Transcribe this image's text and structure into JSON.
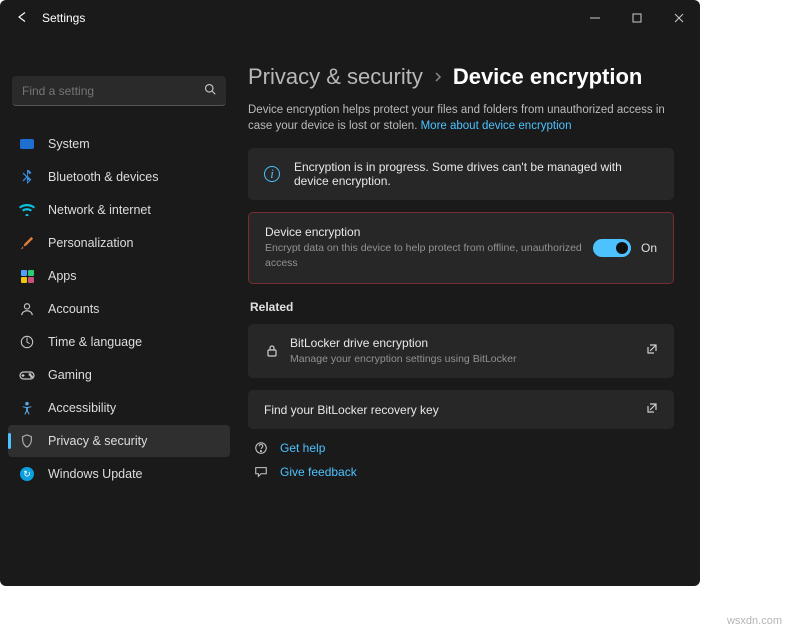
{
  "window": {
    "title": "Settings"
  },
  "search": {
    "placeholder": "Find a setting"
  },
  "sidebar": {
    "items": [
      {
        "id": "system",
        "label": "System"
      },
      {
        "id": "bluetooth",
        "label": "Bluetooth & devices"
      },
      {
        "id": "network",
        "label": "Network & internet"
      },
      {
        "id": "personalization",
        "label": "Personalization"
      },
      {
        "id": "apps",
        "label": "Apps"
      },
      {
        "id": "accounts",
        "label": "Accounts"
      },
      {
        "id": "time",
        "label": "Time & language"
      },
      {
        "id": "gaming",
        "label": "Gaming"
      },
      {
        "id": "accessibility",
        "label": "Accessibility"
      },
      {
        "id": "privacy",
        "label": "Privacy & security"
      },
      {
        "id": "update",
        "label": "Windows Update"
      }
    ],
    "active_index": 9
  },
  "breadcrumb": {
    "parent": "Privacy & security",
    "current": "Device encryption"
  },
  "description": {
    "text": "Device encryption helps protect your files and folders from unauthorized access in case your device is lost or stolen.",
    "link": "More about device encryption"
  },
  "info_banner": {
    "text": "Encryption is in progress. Some drives can't be managed with device encryption."
  },
  "encryption_card": {
    "title": "Device encryption",
    "subtitle": "Encrypt data on this device to help protect from offline, unauthorized access",
    "toggle_state": "On",
    "toggle_on": true
  },
  "related": {
    "heading": "Related",
    "bitlocker": {
      "title": "BitLocker drive encryption",
      "subtitle": "Manage your encryption settings using BitLocker"
    },
    "recovery": {
      "title": "Find your BitLocker recovery key"
    }
  },
  "help": {
    "get_help": "Get help",
    "feedback": "Give feedback"
  },
  "watermark": "wsxdn.com"
}
